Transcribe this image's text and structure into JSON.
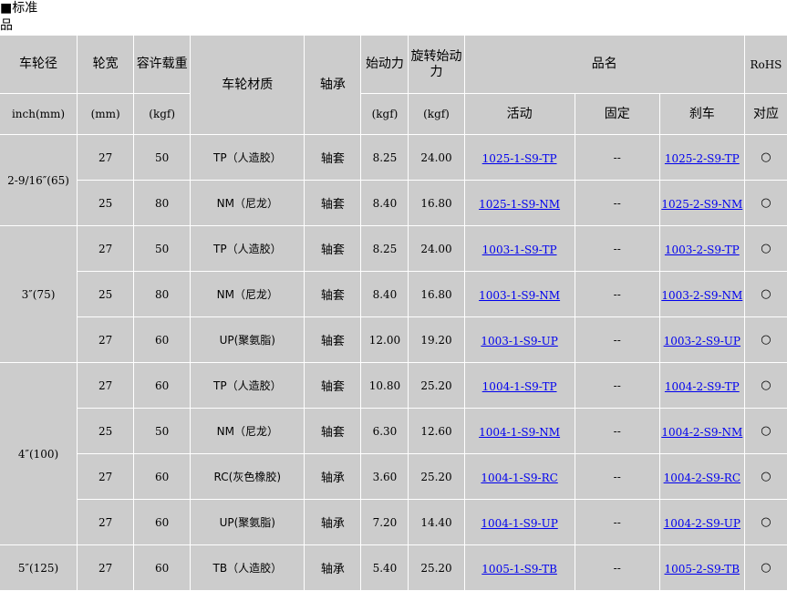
{
  "heading": {
    "marker": "■",
    "line1": "标准",
    "line2": "品"
  },
  "header": {
    "diameter": "车轮径",
    "diameter_unit": "inch(mm)",
    "width": "轮宽",
    "width_unit": "(mm)",
    "load": "容许载重",
    "load_unit": "(kgf)",
    "material": "车轮材质",
    "bearing": "轴承",
    "start_force": "始动力",
    "start_force_unit": "(kgf)",
    "rotate_force": "旋转始动力",
    "rotate_force_unit": "(kgf)",
    "product_name": "品名",
    "swivel": "活动",
    "fixed": "固定",
    "brake": "刹车",
    "rohs": "RoHS",
    "rohs_sub": "对应"
  },
  "groups": [
    {
      "diameter": "2-9/16″(65)",
      "rows": [
        {
          "width": "27",
          "load": "50",
          "material": "TP（人造胶）",
          "bearing": "轴套",
          "start": "8.25",
          "rotate": "24.00",
          "swivel": "1025-1-S9-TP",
          "fixed": "--",
          "brake": "1025-2-S9-TP",
          "rohs": "○"
        },
        {
          "width": "25",
          "load": "80",
          "material": "NM（尼龙）",
          "bearing": "轴套",
          "start": "8.40",
          "rotate": "16.80",
          "swivel": "1025-1-S9-NM",
          "fixed": "--",
          "brake": "1025-2-S9-NM",
          "rohs": "○"
        }
      ]
    },
    {
      "diameter": "3″(75)",
      "rows": [
        {
          "width": "27",
          "load": "50",
          "material": "TP（人造胶）",
          "bearing": "轴套",
          "start": "8.25",
          "rotate": "24.00",
          "swivel": "1003-1-S9-TP",
          "fixed": "--",
          "brake": "1003-2-S9-TP",
          "rohs": "○"
        },
        {
          "width": "25",
          "load": "80",
          "material": "NM（尼龙）",
          "bearing": "轴套",
          "start": "8.40",
          "rotate": "16.80",
          "swivel": "1003-1-S9-NM",
          "fixed": "--",
          "brake": "1003-2-S9-NM",
          "rohs": "○"
        },
        {
          "width": "27",
          "load": "60",
          "material": "UP(聚氨脂)",
          "bearing": "轴套",
          "start": "12.00",
          "rotate": "19.20",
          "swivel": "1003-1-S9-UP",
          "fixed": "--",
          "brake": "1003-2-S9-UP",
          "rohs": "○"
        }
      ]
    },
    {
      "diameter": "4″(100)",
      "rows": [
        {
          "width": "27",
          "load": "60",
          "material": "TP（人造胶）",
          "bearing": "轴套",
          "start": "10.80",
          "rotate": "25.20",
          "swivel": "1004-1-S9-TP",
          "fixed": "--",
          "brake": "1004-2-S9-TP",
          "rohs": "○"
        },
        {
          "width": "25",
          "load": "50",
          "material": "NM（尼龙）",
          "bearing": "轴套",
          "start": "6.30",
          "rotate": "12.60",
          "swivel": "1004-1-S9-NM",
          "fixed": "--",
          "brake": "1004-2-S9-NM",
          "rohs": "○"
        },
        {
          "width": "27",
          "load": "60",
          "material": "RC(灰色橡胶)",
          "bearing": "轴承",
          "start": "3.60",
          "rotate": "25.20",
          "swivel": "1004-1-S9-RC",
          "fixed": "--",
          "brake": "1004-2-S9-RC",
          "rohs": "○"
        },
        {
          "width": "27",
          "load": "60",
          "material": "UP(聚氨脂)",
          "bearing": "轴承",
          "start": "7.20",
          "rotate": "14.40",
          "swivel": "1004-1-S9-UP",
          "fixed": "--",
          "brake": "1004-2-S9-UP",
          "rohs": "○"
        }
      ]
    },
    {
      "diameter": "5″(125)",
      "rows": [
        {
          "width": "27",
          "load": "60",
          "material": "TB（人造胶）",
          "bearing": "轴承",
          "start": "5.40",
          "rotate": "25.20",
          "swivel": "1005-1-S9-TB",
          "fixed": "--",
          "brake": "1005-2-S9-TB",
          "rohs": "○"
        }
      ]
    }
  ]
}
